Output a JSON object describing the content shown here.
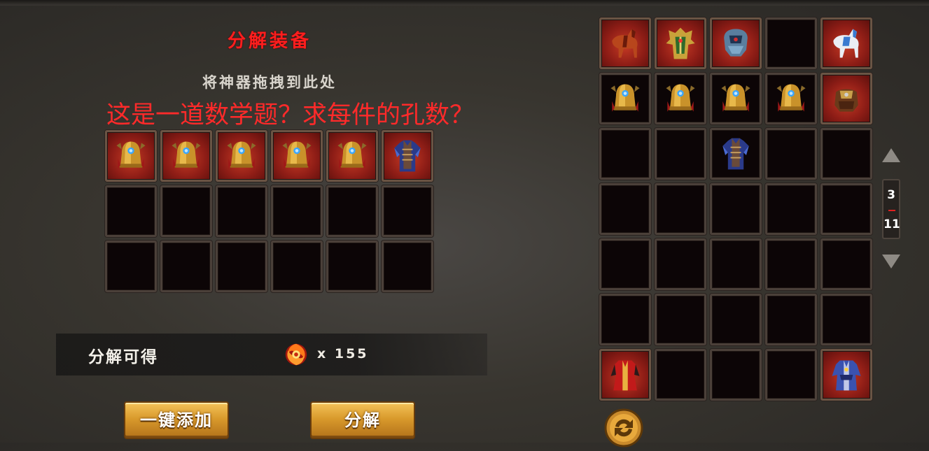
{
  "header": {
    "title": "分解装备",
    "hint": "将神器拖拽到此处",
    "question": "这是一道数学题？求每件的孔数？"
  },
  "decompose_slots": [
    {
      "item": "bell-icon"
    },
    {
      "item": "bell-icon"
    },
    {
      "item": "bell-icon"
    },
    {
      "item": "bell-icon"
    },
    {
      "item": "bell-icon"
    },
    {
      "item": "blue-armor-icon"
    },
    {
      "item": null
    },
    {
      "item": null
    },
    {
      "item": null
    },
    {
      "item": null
    },
    {
      "item": null
    },
    {
      "item": null
    },
    {
      "item": null
    },
    {
      "item": null
    },
    {
      "item": null
    },
    {
      "item": null
    },
    {
      "item": null
    },
    {
      "item": null
    }
  ],
  "inventory_slots": [
    {
      "item": "red-horse-icon",
      "bg": "red"
    },
    {
      "item": "golden-armor-icon",
      "bg": "red"
    },
    {
      "item": "blue-helmet-icon",
      "bg": "red"
    },
    {
      "item": null
    },
    {
      "item": "white-horse-icon",
      "bg": "red"
    },
    {
      "item": "bell-icon",
      "bg": "dark"
    },
    {
      "item": "bell-icon",
      "bg": "dark"
    },
    {
      "item": "bell-icon",
      "bg": "dark"
    },
    {
      "item": "bell-icon",
      "bg": "dark"
    },
    {
      "item": "saddle-icon",
      "bg": "red"
    },
    {
      "item": null
    },
    {
      "item": null
    },
    {
      "item": "blue-armor-icon",
      "bg": "dark"
    },
    {
      "item": null
    },
    {
      "item": null
    },
    {
      "item": null
    },
    {
      "item": null
    },
    {
      "item": null
    },
    {
      "item": null
    },
    {
      "item": null
    },
    {
      "item": null
    },
    {
      "item": null
    },
    {
      "item": null
    },
    {
      "item": null
    },
    {
      "item": null
    },
    {
      "item": null
    },
    {
      "item": null
    },
    {
      "item": null
    },
    {
      "item": null
    },
    {
      "item": null
    },
    {
      "item": "red-robe-icon",
      "bg": "red"
    },
    {
      "item": null
    },
    {
      "item": null
    },
    {
      "item": null
    },
    {
      "item": "blue-robe-icon",
      "bg": "red"
    }
  ],
  "reward": {
    "label": "分解可得",
    "icon": "fire-orb-icon",
    "amount": "x 155"
  },
  "buttons": {
    "add_all": "一键添加",
    "decompose": "分解"
  },
  "pagination": {
    "current": "3",
    "total": "11"
  },
  "colors": {
    "title": "#ff1e1e",
    "question": "#ff2a2a",
    "button": "#d99a2c",
    "slot_bg": "#0c0506",
    "item_bg": "#8e1d16"
  }
}
